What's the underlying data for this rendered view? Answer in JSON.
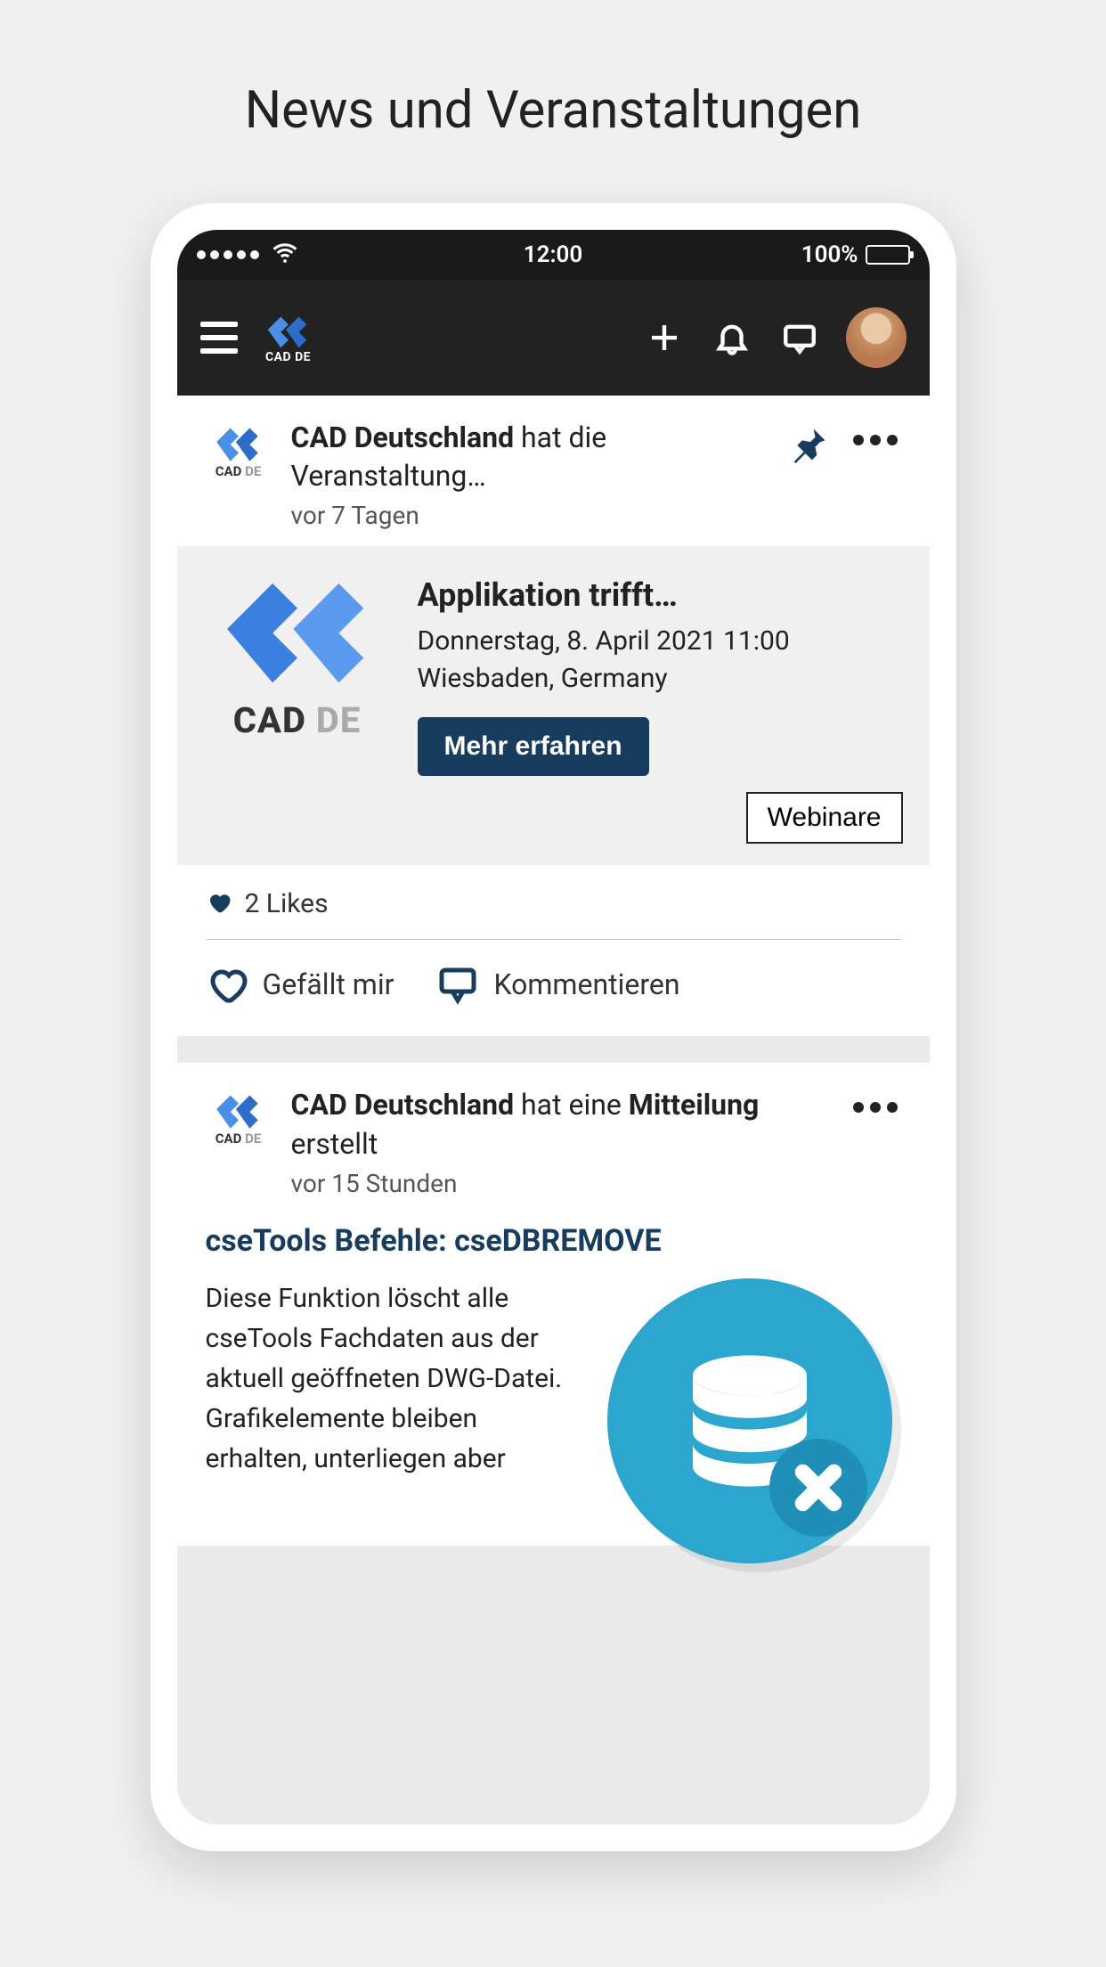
{
  "page": {
    "title": "News und Veranstaltungen"
  },
  "statusBar": {
    "time": "12:00",
    "battery": "100%"
  },
  "header": {
    "logoText": "CAD DE"
  },
  "post1": {
    "logoText": "CAD DE",
    "author": "CAD Deutschland",
    "bylineSuffix": " hat die Veranstaltung…",
    "time": "vor 7 Tagen",
    "event": {
      "logoCad": "CAD",
      "logoDe": " DE",
      "title": "Applikation trifft…",
      "date": "Donnerstag, 8. April 2021 11:00",
      "location": "Wiesbaden, Germany",
      "button": "Mehr erfahren",
      "tag": "Webinare"
    },
    "likes": "2 Likes",
    "actions": {
      "like": "Gefällt mir",
      "comment": "Kommentieren"
    }
  },
  "post2": {
    "logoText": "CAD DE",
    "author": "CAD Deutschland",
    "bylineMid": " hat eine ",
    "bylineBold2": "Mitteilung",
    "bylineEnd": " erstellt",
    "time": "vor 15 Stunden",
    "articleTitle": "cseTools Befehle: cseDBREMOVE",
    "articleText": "Diese Funktion löscht alle cseTools Fachdaten aus der aktuell geöffneten DWG-Datei. Grafikelemente bleiben erhalten, unterliegen aber"
  }
}
